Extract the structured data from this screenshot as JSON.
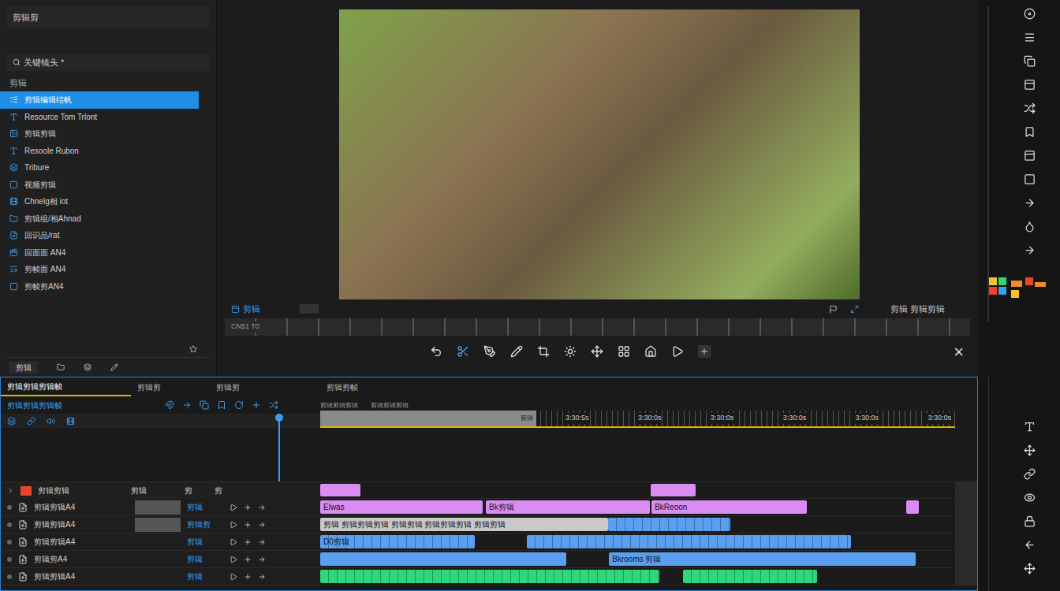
{
  "left_panel": {
    "project_field": "剪辑剪",
    "search_field": "关键镜头 *",
    "section": "剪辑",
    "items": [
      {
        "label": "剪辑编辑结帆",
        "selected": true
      },
      {
        "label": "Resource Tom Trlont",
        "selected": false
      },
      {
        "label": "剪辑剪辑",
        "selected": false
      },
      {
        "label": "Resoole Rubon",
        "selected": false
      },
      {
        "label": "Tribure",
        "selected": false
      },
      {
        "label": "视频剪辑",
        "selected": false
      },
      {
        "label": "Chnelg相 iot",
        "selected": false
      },
      {
        "label": "剪辑组/相Ahnad",
        "selected": false
      },
      {
        "label": "回识品/rat",
        "selected": false
      },
      {
        "label": "回面面 AN4",
        "selected": false
      },
      {
        "label": "剪帧面 AN4",
        "selected": false
      },
      {
        "label": "剪帧剪AN4",
        "selected": false
      }
    ],
    "footer_label": "剪辑"
  },
  "preview": {
    "view_label": "剪辑",
    "info_label": "剪辑 剪辑剪辑",
    "timecode": "CN51 T0",
    "close": "×"
  },
  "timeline": {
    "tabs": [
      {
        "label": "剪辑剪辑剪辑帧",
        "selected": true
      },
      {
        "label": "剪辑剪",
        "selected": false
      },
      {
        "label": "剪辑剪",
        "selected": false
      },
      {
        "label": "剪辑剪帧",
        "selected": false
      }
    ],
    "sequence": "剪辑剪辑剪辑帧",
    "ruler_labels": [
      "剪辑剪辑剪辑",
      "剪辑剪辑剪辑"
    ],
    "progress": {
      "label": "剪辑",
      "level": 0.34
    },
    "ruler": [
      "3:30:5s",
      "3:30:0s",
      "3:30:0s",
      "3:30:0s",
      "3:30:0s",
      "3:30:0s"
    ],
    "group": {
      "name": "剪辑剪辑",
      "columns": [
        "剪辑",
        "剪",
        "剪"
      ],
      "clips": [
        {
          "label": "",
          "start": 0,
          "length": 0.063,
          "color": "#d98cf2",
          "kind": "solid"
        },
        {
          "label": "",
          "start": 0.521,
          "length": 0.07,
          "color": "#d98cf2",
          "kind": "solid"
        }
      ]
    },
    "tracks": [
      {
        "name": "剪辑剪辑A4",
        "target": "剪辑",
        "clips": [
          {
            "label": "Elwas",
            "start": 0,
            "length": 0.256,
            "color": "#d98cf2",
            "kind": "solid"
          },
          {
            "label": "Bk剪辑",
            "start": 0.261,
            "length": 0.258,
            "color": "#d98cf2",
            "kind": "solid"
          },
          {
            "label": "BkReoon",
            "start": 0.522,
            "length": 0.244,
            "color": "#d98cf2",
            "kind": "solid"
          },
          {
            "label": "",
            "start": 0.923,
            "length": 0.02,
            "color": "#d98cf2",
            "kind": "solid"
          }
        ]
      },
      {
        "name": "剪辑剪辑A4",
        "target": "剪辑剪",
        "clips": [
          {
            "label": "剪辑 剪辑剪辑剪辑 剪辑剪辑 剪辑剪辑剪辑 剪辑剪辑",
            "start": 0,
            "length": 0.453,
            "color": "#c9c9c9",
            "kind": "solid"
          },
          {
            "label": "",
            "start": 0.453,
            "length": 0.193,
            "color": "#5b9ff0",
            "kind": "segmented"
          }
        ]
      },
      {
        "name": "剪辑剪辑A4",
        "target": "剪辑",
        "clips": [
          {
            "label": "D0剪辑",
            "start": 0,
            "length": 0.244,
            "color": "#5b9ff0",
            "kind": "segmented"
          },
          {
            "label": "",
            "start": 0.326,
            "length": 0.51,
            "color": "#5b9ff0",
            "kind": "segmented"
          }
        ]
      },
      {
        "name": "剪辑剪A4",
        "target": "剪辑",
        "clips": [
          {
            "label": "",
            "start": 0,
            "length": 0.387,
            "color": "#5b9ff0",
            "kind": "solid"
          },
          {
            "label": "Bkrooms 剪辑",
            "start": 0.455,
            "length": 0.483,
            "color": "#5b9ff0",
            "kind": "solid"
          }
        ]
      },
      {
        "name": "剪辑剪辑A4",
        "target": "剪辑",
        "clips": [
          {
            "label": "",
            "start": 0,
            "length": 0.534,
            "color": "#2fd67a",
            "kind": "segmented"
          },
          {
            "label": "",
            "start": 0.572,
            "length": 0.211,
            "color": "#2fd67a",
            "kind": "segmented"
          }
        ]
      }
    ]
  }
}
